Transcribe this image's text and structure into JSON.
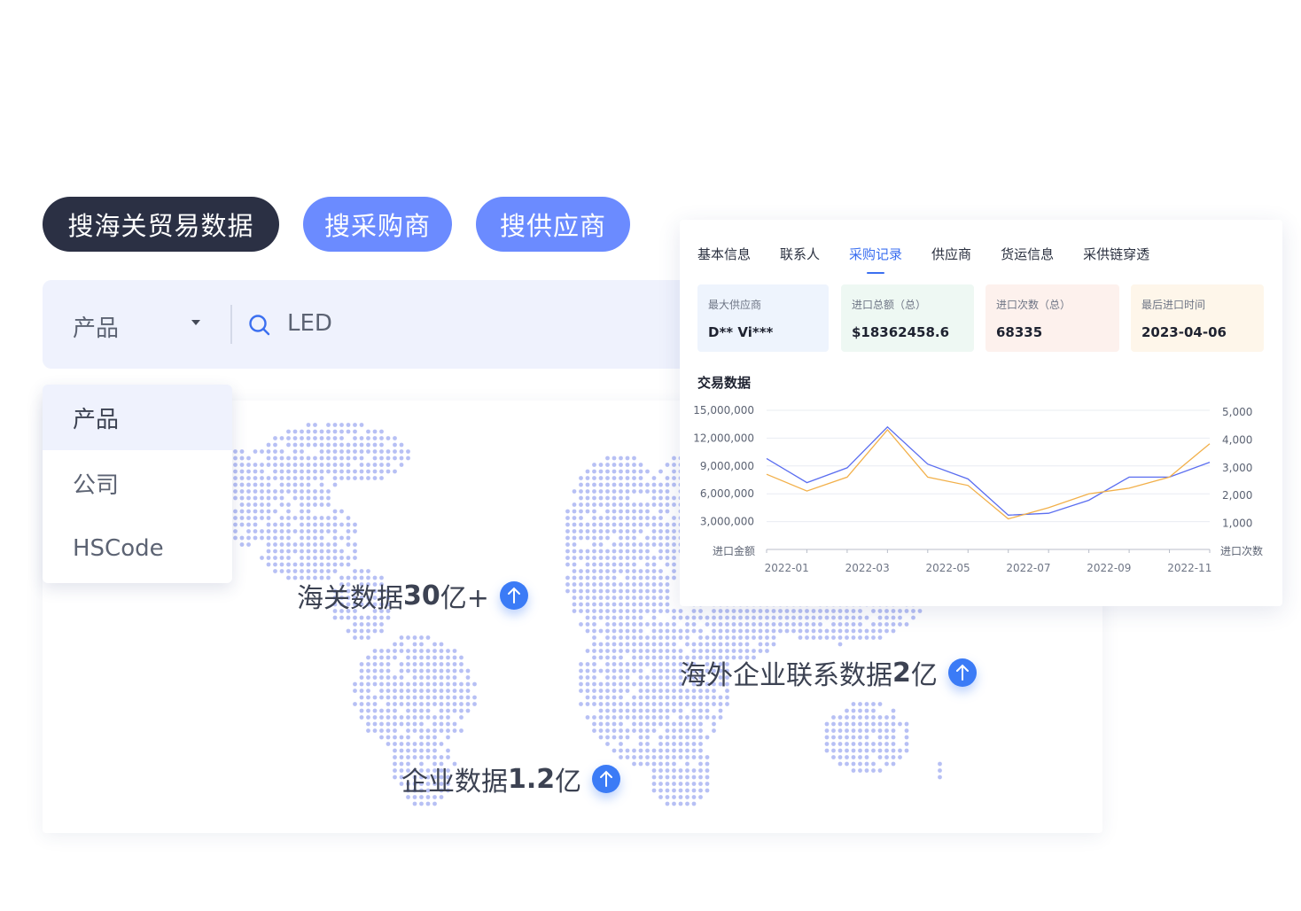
{
  "modes": {
    "customs": "搜海关贸易数据",
    "buyers": "搜采购商",
    "suppliers": "搜供应商"
  },
  "search": {
    "select_value": "产品",
    "query": "LED"
  },
  "dropdown": {
    "options": [
      "产品",
      "公司",
      "HSCode"
    ]
  },
  "stats": {
    "customs": {
      "prefix": "海关数据 ",
      "value": "30",
      "suffix": " 亿+"
    },
    "overseas": {
      "prefix": "海外企业联系数据 ",
      "value": "2",
      "suffix": " 亿"
    },
    "enterprise": {
      "prefix": "企业数据 ",
      "value": "1.2",
      "suffix": " 亿"
    },
    "icon": "arrow-up-icon"
  },
  "panel": {
    "tabs": [
      "基本信息",
      "联系人",
      "采购记录",
      "供应商",
      "货运信息",
      "采供链穿透"
    ],
    "active_tab": 2,
    "kpis": [
      {
        "label": "最大供应商",
        "value": "D** Vi***"
      },
      {
        "label": "进口总额（总）",
        "value": "$18362458.6"
      },
      {
        "label": "进口次数（总）",
        "value": "68335"
      },
      {
        "label": "最后进口时间",
        "value": "2023-04-06"
      }
    ],
    "chart_title": "交易数据"
  },
  "chart_data": {
    "type": "line",
    "title": "交易数据",
    "x": [
      "2022-01",
      "2022-02",
      "2022-03",
      "2022-04",
      "2022-05",
      "2022-06",
      "2022-07",
      "2022-08",
      "2022-09",
      "2022-10",
      "2022-11",
      "2022-12"
    ],
    "x_tick_labels": [
      "2022-01",
      "2022-03",
      "2022-05",
      "2022-07",
      "2022-09",
      "2022-11"
    ],
    "y_left": {
      "label": "进口金额",
      "ticks": [
        "15,000,000",
        "12,000,000",
        "9,000,000",
        "6,000,000",
        "3,000,000"
      ],
      "range": [
        0,
        15000000
      ]
    },
    "y_right": {
      "label": "进口次数",
      "ticks": [
        "5,000",
        "4,000",
        "3,000",
        "2,000",
        "1,000"
      ],
      "range": [
        0,
        5000
      ]
    },
    "series": [
      {
        "axis": "left",
        "color": "#5b6ef0",
        "values": [
          9800000,
          7200000,
          8800000,
          13200000,
          9200000,
          7600000,
          3700000,
          3900000,
          5300000,
          7800000,
          7800000,
          9400000
        ]
      },
      {
        "axis": "right",
        "color": "#f2b04a",
        "values": [
          2700,
          2100,
          2600,
          4300,
          2600,
          2300,
          1100,
          1500,
          2000,
          2200,
          2600,
          3800
        ]
      }
    ],
    "grid": true
  },
  "colors": {
    "dark": "#2b3044",
    "accent": "#6b8bff",
    "blue": "#3b7bf6",
    "map_dot": "#b7c0f4"
  }
}
